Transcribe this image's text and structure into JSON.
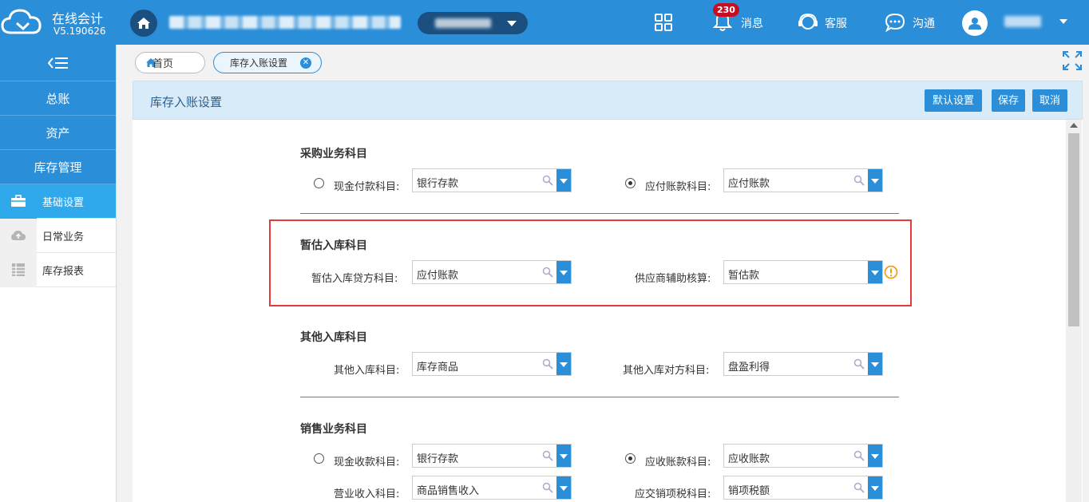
{
  "app": {
    "name": "在线会计",
    "version": "V5.190626",
    "company_name": "████ ████████████████ ████",
    "account_set": "████████",
    "user_name": "████"
  },
  "header": {
    "badge_count": "230",
    "messages_label": "消息",
    "service_label": "客服",
    "chat_label": "沟通",
    "icons": [
      "cloud-logo-icon",
      "home-icon",
      "apps-grid-icon",
      "bell-icon",
      "headset-icon",
      "chat-bubble-icon",
      "user-icon"
    ]
  },
  "sidebar": {
    "categories": [
      {
        "label": "总账"
      },
      {
        "label": "资产"
      },
      {
        "label": "库存管理"
      }
    ],
    "items": [
      {
        "label": "基础设置",
        "icon": "briefcase-icon",
        "active": true
      },
      {
        "label": "日常业务",
        "icon": "cloud-upload-icon",
        "active": false
      },
      {
        "label": "库存报表",
        "icon": "table-icon",
        "active": false
      }
    ]
  },
  "tabs": {
    "home": "首页",
    "current": "库存入账设置"
  },
  "page": {
    "title": "库存入账设置",
    "buttons": {
      "default_settings": "默认设置",
      "save": "保存",
      "cancel": "取消"
    }
  },
  "sections": {
    "purchase": {
      "title": "采购业务科目",
      "cash_pay_label": "现金付款科目:",
      "cash_pay_value": "银行存款",
      "cash_pay_selected": false,
      "payable_label": "应付账款科目:",
      "payable_value": "应付账款",
      "payable_selected": true
    },
    "estimated": {
      "title": "暂估入库科目",
      "credit_label": "暂估入库贷方科目:",
      "credit_value": "应付账款",
      "supplier_label": "供应商辅助核算:",
      "supplier_value": "暂估款"
    },
    "other": {
      "title": "其他入库科目",
      "in_label": "其他入库科目:",
      "in_value": "库存商品",
      "counter_label": "其他入库对方科目:",
      "counter_value": "盘盈利得"
    },
    "sales": {
      "title": "销售业务科目",
      "cash_recv_label": "现金收款科目:",
      "cash_recv_value": "银行存款",
      "cash_recv_selected": false,
      "receivable_label": "应收账款科目:",
      "receivable_value": "应收账款",
      "receivable_selected": true,
      "revenue_label": "营业收入科目:",
      "revenue_value": "商品销售收入",
      "tax_label": "应交销项税科目:",
      "tax_value": "销项税额"
    }
  },
  "colors": {
    "primary": "#2a8ed8",
    "highlight_border": "#e33b3b",
    "badge": "#c40f22",
    "warning": "#f0a020"
  }
}
